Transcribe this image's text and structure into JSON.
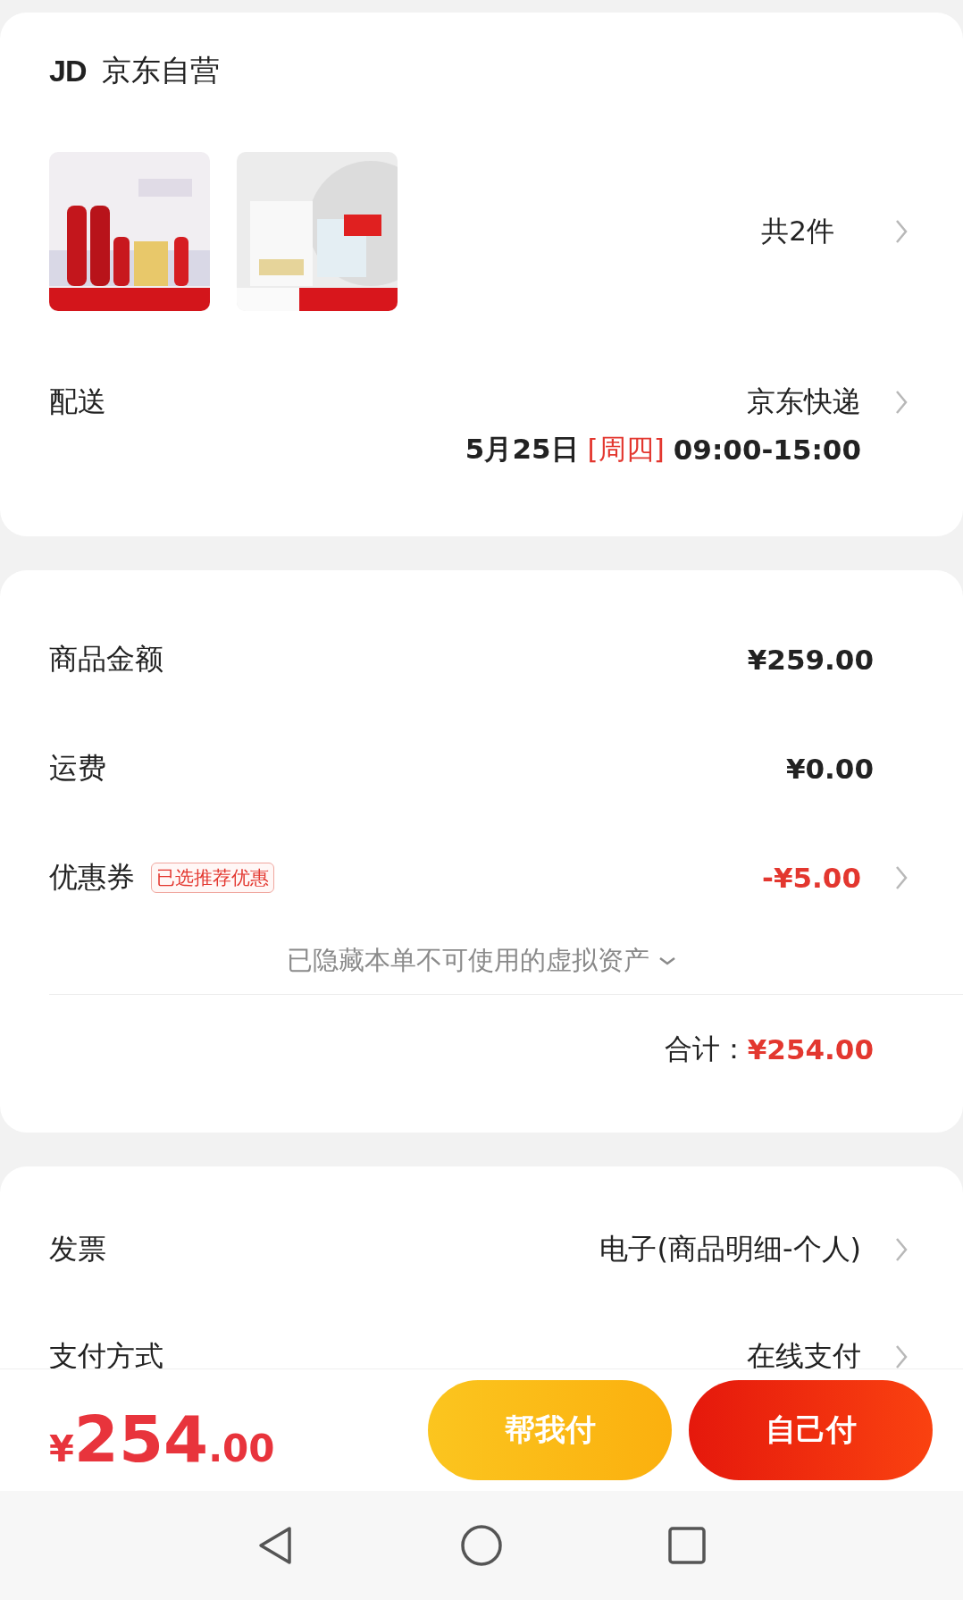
{
  "store": {
    "logo": "JD",
    "name": "京东自营"
  },
  "products": {
    "count": "共2件"
  },
  "delivery": {
    "label": "配送",
    "method": "京东快递",
    "date": "5月25日",
    "weekday": "[周四]",
    "time": "09:00-15:00"
  },
  "summary": {
    "rows": [
      {
        "kind": "amount",
        "label": "商品金额",
        "value": "¥259.00"
      },
      {
        "kind": "amount",
        "label": "运费",
        "value": "¥0.00"
      },
      {
        "kind": "discount",
        "label": "优惠券",
        "tag": "已选推荐优惠",
        "value": "-¥5.00"
      }
    ],
    "hidden_note": "已隐藏本单不可使用的虚拟资产",
    "total_label": "合计：",
    "total": "¥254.00"
  },
  "options": [
    {
      "label": "发票",
      "value": "电子(商品明细-个人)"
    },
    {
      "label": "支付方式",
      "value": "在线支付"
    }
  ],
  "footer": {
    "currency": "¥",
    "price_main": "254",
    "price_cents": ".00",
    "buttons": [
      {
        "kind": "secondary",
        "label": "帮我付"
      },
      {
        "kind": "primary",
        "label": "自己付"
      }
    ]
  }
}
